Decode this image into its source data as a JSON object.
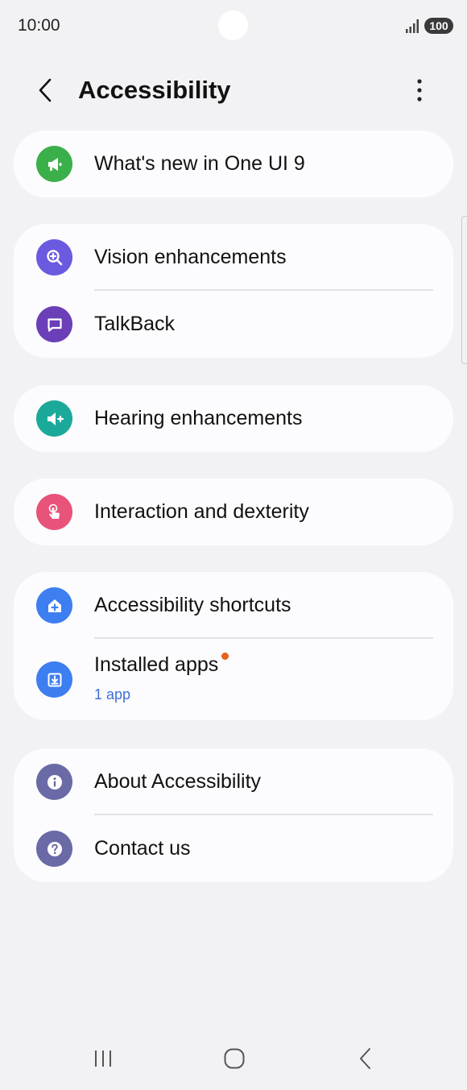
{
  "status_bar": {
    "time": "10:00",
    "battery": "100",
    "signal_icon": "signal-icon"
  },
  "header": {
    "title": "Accessibility",
    "back_icon": "chevron-left-icon",
    "more_icon": "more-vertical-icon"
  },
  "sections": [
    {
      "items": [
        {
          "label": "What's new in One UI 9",
          "icon": "megaphone-icon",
          "color": "#3bb04a"
        }
      ]
    },
    {
      "items": [
        {
          "label": "Vision enhancements",
          "icon": "zoom-in-icon",
          "color": "#6a5adf"
        },
        {
          "label": "TalkBack",
          "icon": "chat-bubble-icon",
          "color": "#6b3fb8"
        }
      ]
    },
    {
      "items": [
        {
          "label": "Hearing enhancements",
          "icon": "speaker-plus-icon",
          "color": "#1ba99a"
        }
      ]
    },
    {
      "items": [
        {
          "label": "Interaction and dexterity",
          "icon": "touch-hand-icon",
          "color": "#e8537a"
        }
      ]
    },
    {
      "items": [
        {
          "label": "Accessibility shortcuts",
          "icon": "home-plus-icon",
          "color": "#3d7ef0"
        },
        {
          "label": "Installed apps",
          "subtitle": "1 app",
          "icon": "download-icon",
          "color": "#3d7ef0",
          "badge_color": "#e8611d"
        }
      ]
    },
    {
      "items": [
        {
          "label": "About Accessibility",
          "icon": "info-icon",
          "color": "#6a6aa6"
        },
        {
          "label": "Contact us",
          "icon": "question-icon",
          "color": "#6a6aa6"
        }
      ]
    }
  ],
  "nav_bar": {
    "recents_icon": "recents-icon",
    "home_icon": "home-icon",
    "back_icon": "back-icon"
  }
}
